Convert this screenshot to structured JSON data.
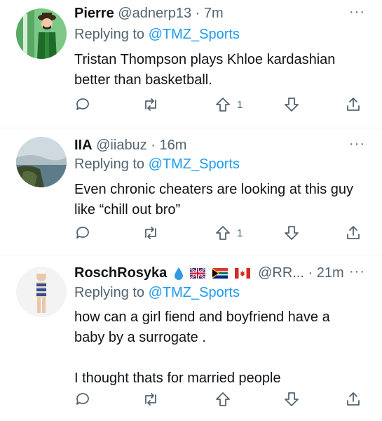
{
  "tweets": [
    {
      "display_name": "Pierre",
      "handle": "@adnerp13",
      "separator": "·",
      "time": "7m",
      "reply_prefix": "Replying to",
      "reply_to": "@TMZ_Sports",
      "text_lines": [
        "Tristan Thompson plays Khloe kardashian",
        "better than basketball."
      ],
      "like_count": "1",
      "more_icon": "···"
    },
    {
      "display_name": "IIA",
      "handle": "@iiabuz",
      "separator": "·",
      "time": "16m",
      "reply_prefix": "Replying to",
      "reply_to": "@TMZ_Sports",
      "text_lines": [
        "Even chronic cheaters are looking at this guy",
        "like “chill out bro”"
      ],
      "like_count": "1",
      "more_icon": "···"
    },
    {
      "display_name": "RoschRosyka",
      "handle": "@RR...",
      "separator": "·",
      "time": "21m",
      "reply_prefix": "Replying to",
      "reply_to": "@TMZ_Sports",
      "text_lines": [
        "how can a girl fiend and boyfriend have a",
        "baby by a surrogate .",
        "",
        "I thought thats for married people"
      ],
      "like_count": "",
      "more_icon": "···",
      "name_emoji": [
        "droplet-icon",
        "uk-flag-icon",
        "south-africa-flag-icon",
        "canada-flag-icon"
      ]
    }
  ],
  "colors": {
    "link": "#1d9bf0",
    "muted": "#536471",
    "text": "#0f1419",
    "divider": "#eff3f4"
  }
}
